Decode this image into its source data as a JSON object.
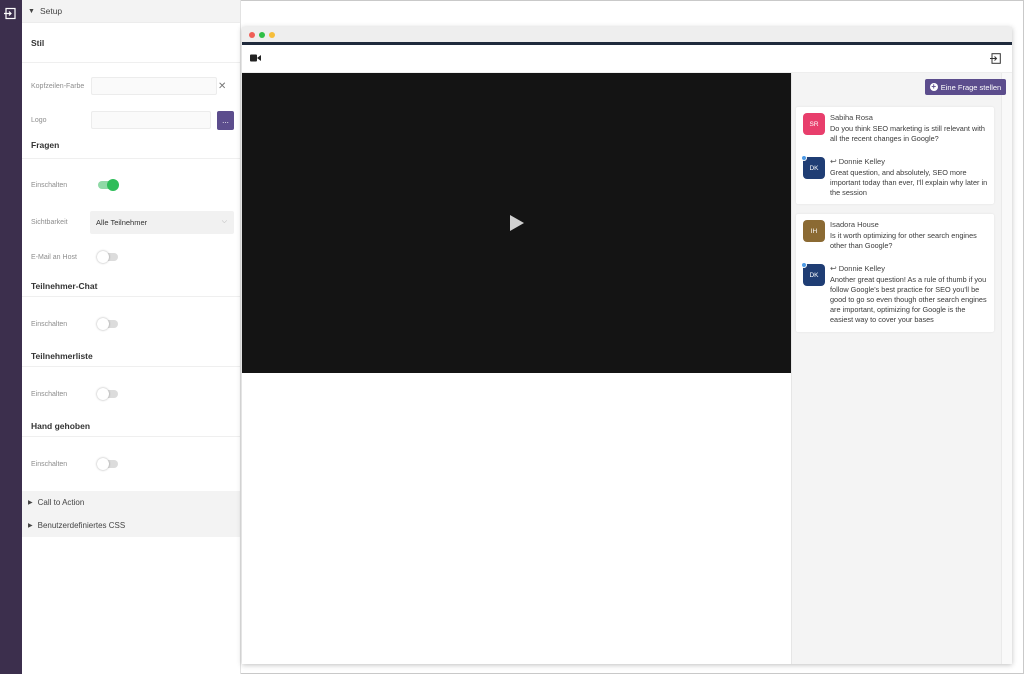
{
  "panel": {
    "setup_label": "Setup",
    "stil_title": "Stil",
    "header_color_label": "Kopfzeilen-Farbe",
    "logo_label": "Logo",
    "logo_button": "...",
    "fragen_title": "Fragen",
    "fragen_enable_label": "Einschalten",
    "visibility_label": "Sichtbarkeit",
    "visibility_value": "Alle Teilnehmer",
    "email_host_label": "E-Mail an Host",
    "chat_title": "Teilnehmer-Chat",
    "chat_enable_label": "Einschalten",
    "list_title": "Teilnehmerliste",
    "list_enable_label": "Einschalten",
    "hand_title": "Hand gehoben",
    "hand_enable_label": "Einschalten",
    "cta_label": "Call to Action",
    "css_label": "Benutzerdefiniertes CSS",
    "toggles": {
      "fragen": true,
      "email_host": false,
      "chat": false,
      "list": false,
      "hand": false
    }
  },
  "preview": {
    "ask_button": "Eine Frage stellen",
    "questions": [
      {
        "author_initials": "SR",
        "author_name": "Sabiha Rosa",
        "author_color": "#e83e6c",
        "question": "Do you think SEO marketing is still relevant with all the recent changes in Google?",
        "reply_initials": "DK",
        "reply_name": "Donnie Kelley",
        "reply_color": "#1f3d74",
        "reply": "Great question, and absolutely, SEO more important today than ever, I'll explain why later in the session"
      },
      {
        "author_initials": "IH",
        "author_name": "Isadora House",
        "author_color": "#8b6a33",
        "question": "Is it worth optimizing for other search engines other than Google?",
        "reply_initials": "DK",
        "reply_name": "Donnie Kelley",
        "reply_color": "#1f3d74",
        "reply": "Another great question! As a rule of thumb if you follow Google's best practice for SEO you'll be good to go so even though other search engines are important, optimizing for Google is the easiest way to cover your bases"
      }
    ]
  },
  "colors": {
    "sidebar": "#3c2f4d",
    "accent": "#5c4d8d",
    "toggle_on": "#2ebd59",
    "window_close": "#f05f57",
    "window_min": "#2fbf47",
    "window_max": "#f6be3b"
  }
}
